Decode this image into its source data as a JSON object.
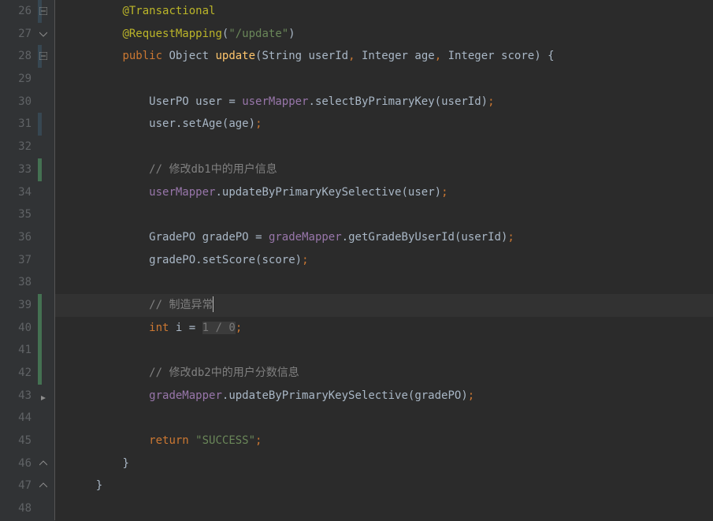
{
  "lines": [
    {
      "num": "26",
      "vcs": "blue",
      "fold": "minus"
    },
    {
      "num": "27",
      "vcs": "",
      "fold": "open-top"
    },
    {
      "num": "28",
      "vcs": "blue",
      "fold": "minus"
    },
    {
      "num": "29",
      "vcs": "",
      "fold": ""
    },
    {
      "num": "30",
      "vcs": "",
      "fold": ""
    },
    {
      "num": "31",
      "vcs": "blue",
      "fold": ""
    },
    {
      "num": "32",
      "vcs": "",
      "fold": ""
    },
    {
      "num": "33",
      "vcs": "green",
      "fold": ""
    },
    {
      "num": "34",
      "vcs": "",
      "fold": ""
    },
    {
      "num": "35",
      "vcs": "",
      "fold": ""
    },
    {
      "num": "36",
      "vcs": "",
      "fold": ""
    },
    {
      "num": "37",
      "vcs": "",
      "fold": ""
    },
    {
      "num": "38",
      "vcs": "",
      "fold": ""
    },
    {
      "num": "39",
      "vcs": "green",
      "fold": "",
      "caret": true
    },
    {
      "num": "40",
      "vcs": "green",
      "fold": ""
    },
    {
      "num": "41",
      "vcs": "green",
      "fold": ""
    },
    {
      "num": "42",
      "vcs": "green",
      "fold": ""
    },
    {
      "num": "43",
      "vcs": "",
      "fold": "arrow"
    },
    {
      "num": "44",
      "vcs": "",
      "fold": ""
    },
    {
      "num": "45",
      "vcs": "",
      "fold": ""
    },
    {
      "num": "46",
      "vcs": "",
      "fold": "close"
    },
    {
      "num": "47",
      "vcs": "",
      "fold": "close"
    },
    {
      "num": "48",
      "vcs": "",
      "fold": ""
    }
  ],
  "code": {
    "l26": {
      "indent": "        ",
      "ann": "@Transactional"
    },
    "l27": {
      "indent": "        ",
      "ann": "@RequestMapping",
      "p1": "(",
      "s": "\"/update\"",
      "p2": ")"
    },
    "l28": {
      "indent": "        ",
      "kw1": "public",
      "sp1": " ",
      "type1": "Object",
      "sp2": " ",
      "method": "update",
      "p1": "(",
      "type2": "String",
      "sp3": " ",
      "arg1": "userId",
      "c1": ",",
      "sp4": " ",
      "type3": "Integer",
      "sp5": " ",
      "arg2": "age",
      "c2": ",",
      "sp6": " ",
      "type4": "Integer",
      "sp7": " ",
      "arg3": "score",
      "p2": ")",
      "sp8": " ",
      "brace": "{"
    },
    "l30": {
      "indent": "            ",
      "type": "UserPO",
      "sp1": " ",
      "var": "user",
      "sp2": " ",
      "eq": "=",
      "sp3": " ",
      "field": "userMapper",
      "dot": ".",
      "method": "selectByPrimaryKey",
      "p1": "(",
      "arg": "userId",
      "p2": ")",
      "semi": ";"
    },
    "l31": {
      "indent": "            ",
      "var": "user",
      "dot": ".",
      "method": "setAge",
      "p1": "(",
      "arg": "age",
      "p2": ")",
      "semi": ";"
    },
    "l33": {
      "indent": "            ",
      "comment": "// 修改db1中的用户信息"
    },
    "l34": {
      "indent": "            ",
      "field": "userMapper",
      "dot": ".",
      "method": "updateByPrimaryKeySelective",
      "p1": "(",
      "arg": "user",
      "p2": ")",
      "semi": ";"
    },
    "l36": {
      "indent": "            ",
      "type": "GradePO",
      "sp1": " ",
      "var": "gradePO",
      "sp2": " ",
      "eq": "=",
      "sp3": " ",
      "field": "gradeMapper",
      "dot": ".",
      "method": "getGradeByUserId",
      "p1": "(",
      "arg": "userId",
      "p2": ")",
      "semi": ";"
    },
    "l37": {
      "indent": "            ",
      "var": "gradePO",
      "dot": ".",
      "method": "setScore",
      "p1": "(",
      "arg": "score",
      "p2": ")",
      "semi": ";"
    },
    "l39": {
      "indent": "            ",
      "comment": "// 制造异常"
    },
    "l40": {
      "indent": "            ",
      "kw": "int",
      "sp1": " ",
      "var": "i",
      "sp2": " ",
      "eq": "=",
      "sp3": " ",
      "n1": "1",
      "sp4": " ",
      "div": "/",
      "sp5": " ",
      "n2": "0",
      "semi": ";"
    },
    "l42": {
      "indent": "            ",
      "comment": "// 修改db2中的用户分数信息"
    },
    "l43": {
      "indent": "            ",
      "field": "gradeMapper",
      "dot": ".",
      "method": "updateByPrimaryKeySelective",
      "p1": "(",
      "arg": "gradePO",
      "p2": ")",
      "semi": ";"
    },
    "l45": {
      "indent": "            ",
      "kw": "return",
      "sp": " ",
      "str": "\"SUCCESS\"",
      "semi": ";"
    },
    "l46": {
      "indent": "        ",
      "brace": "}"
    },
    "l47": {
      "indent": "    ",
      "brace": "}"
    }
  }
}
